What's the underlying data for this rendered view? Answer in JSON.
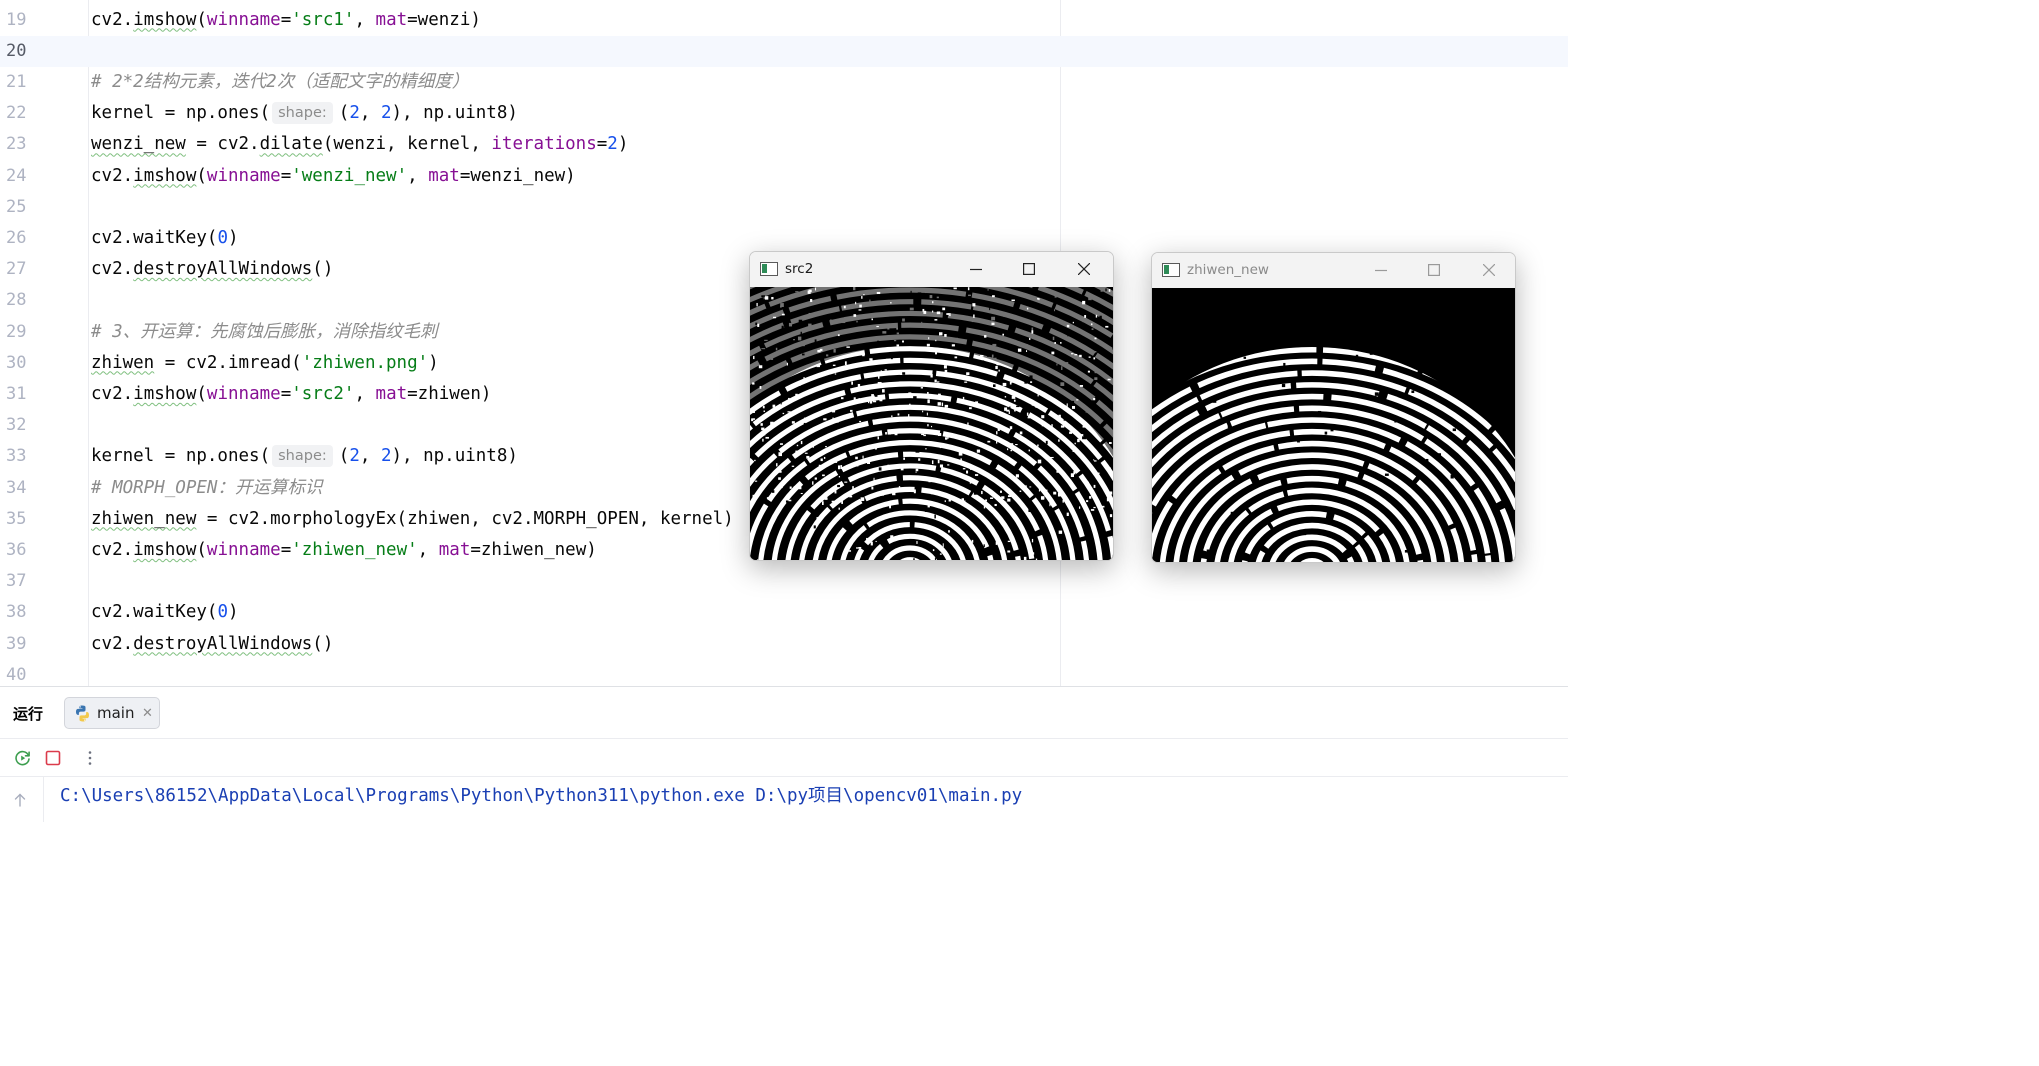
{
  "editor": {
    "current_line": 20,
    "lines": [
      {
        "n": "19",
        "tokens": [
          [
            "",
            "cv2."
          ],
          [
            "wavy",
            "imshow"
          ],
          [
            "",
            "("
          ],
          [
            "param",
            "winname"
          ],
          [
            "",
            "="
          ],
          [
            "str",
            "'src1'"
          ],
          [
            "",
            ", "
          ],
          [
            "param",
            "mat"
          ],
          [
            "",
            "=wenzi)"
          ]
        ]
      },
      {
        "n": "20",
        "tokens": []
      },
      {
        "n": "21",
        "tokens": [
          [
            "comment",
            "# 2*2结构元素，迭代2次（适配文字的精细度）"
          ]
        ]
      },
      {
        "n": "22",
        "tokens": [
          [
            "",
            "kernel = np.ones("
          ],
          [
            "hint",
            "shape:"
          ],
          [
            "",
            "("
          ],
          [
            "num",
            "2"
          ],
          [
            "",
            ", "
          ],
          [
            "num",
            "2"
          ],
          [
            "",
            "), np.uint8)"
          ]
        ]
      },
      {
        "n": "23",
        "tokens": [
          [
            "wavy",
            "wenzi_new"
          ],
          [
            "",
            " = cv2."
          ],
          [
            "wavy",
            "dilate"
          ],
          [
            "",
            "(wenzi, kernel, "
          ],
          [
            "param",
            "iterations"
          ],
          [
            "",
            "="
          ],
          [
            "num",
            "2"
          ],
          [
            "",
            ")"
          ]
        ]
      },
      {
        "n": "24",
        "tokens": [
          [
            "",
            "cv2."
          ],
          [
            "wavy",
            "imshow"
          ],
          [
            "",
            "("
          ],
          [
            "param",
            "winname"
          ],
          [
            "",
            "="
          ],
          [
            "str",
            "'wenzi_new'"
          ],
          [
            "",
            ", "
          ],
          [
            "param",
            "mat"
          ],
          [
            "",
            "=wenzi_new)"
          ]
        ]
      },
      {
        "n": "25",
        "tokens": []
      },
      {
        "n": "26",
        "tokens": [
          [
            "",
            "cv2.waitKey("
          ],
          [
            "num",
            "0"
          ],
          [
            "",
            ")"
          ]
        ]
      },
      {
        "n": "27",
        "tokens": [
          [
            "",
            "cv2."
          ],
          [
            "wavy",
            "destroyAllWindows"
          ],
          [
            "",
            "()"
          ]
        ]
      },
      {
        "n": "28",
        "tokens": []
      },
      {
        "n": "29",
        "tokens": [
          [
            "comment",
            "# 3、开运算：先腐蚀后膨胀，消除指纹毛刺"
          ]
        ]
      },
      {
        "n": "30",
        "tokens": [
          [
            "wavy",
            "zhiwen"
          ],
          [
            "",
            " = cv2.imread("
          ],
          [
            "str",
            "'zhiwen.png'"
          ],
          [
            "",
            ")"
          ]
        ]
      },
      {
        "n": "31",
        "tokens": [
          [
            "",
            "cv2."
          ],
          [
            "wavy",
            "imshow"
          ],
          [
            "",
            "("
          ],
          [
            "param",
            "winname"
          ],
          [
            "",
            "="
          ],
          [
            "str",
            "'src2'"
          ],
          [
            "",
            ", "
          ],
          [
            "param",
            "mat"
          ],
          [
            "",
            "=zhiwen)"
          ]
        ]
      },
      {
        "n": "32",
        "tokens": []
      },
      {
        "n": "33",
        "tokens": [
          [
            "",
            "kernel = np.ones("
          ],
          [
            "hint",
            "shape:"
          ],
          [
            "",
            "("
          ],
          [
            "num",
            "2"
          ],
          [
            "",
            ", "
          ],
          [
            "num",
            "2"
          ],
          [
            "",
            "), np.uint8)"
          ]
        ]
      },
      {
        "n": "34",
        "tokens": [
          [
            "comment",
            "# MORPH_OPEN：开运算标识"
          ]
        ]
      },
      {
        "n": "35",
        "tokens": [
          [
            "wavy",
            "zhiwen_new"
          ],
          [
            "",
            " = cv2.morphologyEx(zhiwen, cv2.MORPH_OPEN, kernel)"
          ]
        ]
      },
      {
        "n": "36",
        "tokens": [
          [
            "",
            "cv2."
          ],
          [
            "wavy",
            "imshow"
          ],
          [
            "",
            "("
          ],
          [
            "param",
            "winname"
          ],
          [
            "",
            "="
          ],
          [
            "str",
            "'zhiwen_new'"
          ],
          [
            "",
            ", "
          ],
          [
            "param",
            "mat"
          ],
          [
            "",
            "=zhiwen_new)"
          ]
        ]
      },
      {
        "n": "37",
        "tokens": []
      },
      {
        "n": "38",
        "tokens": [
          [
            "",
            "cv2.waitKey("
          ],
          [
            "num",
            "0"
          ],
          [
            "",
            ")"
          ]
        ]
      },
      {
        "n": "39",
        "tokens": [
          [
            "",
            "cv2."
          ],
          [
            "wavy",
            "destroyAllWindows"
          ],
          [
            "",
            "()"
          ]
        ]
      },
      {
        "n": "40",
        "tokens": []
      }
    ]
  },
  "windows": [
    {
      "title": "src2",
      "active": true,
      "image": "noisy-fingerprint"
    },
    {
      "title": "zhiwen_new",
      "active": false,
      "image": "opened-fingerprint"
    }
  ],
  "run_panel": {
    "title": "运行",
    "tab_label": "main",
    "tab_icon": "python-icon",
    "toolbar_icons": [
      "rerun-icon",
      "stop-icon",
      "more-options-icon"
    ],
    "console_line": "C:\\Users\\86152\\AppData\\Local\\Programs\\Python\\Python311\\python.exe D:\\py项目\\opencv01\\main.py"
  },
  "colors": {
    "comment": "#8c8c8c",
    "parameter": "#871094",
    "string": "#067d17",
    "number": "#1750eb",
    "console_path": "#1a3fb3",
    "current_line": "#f5f8fe"
  }
}
